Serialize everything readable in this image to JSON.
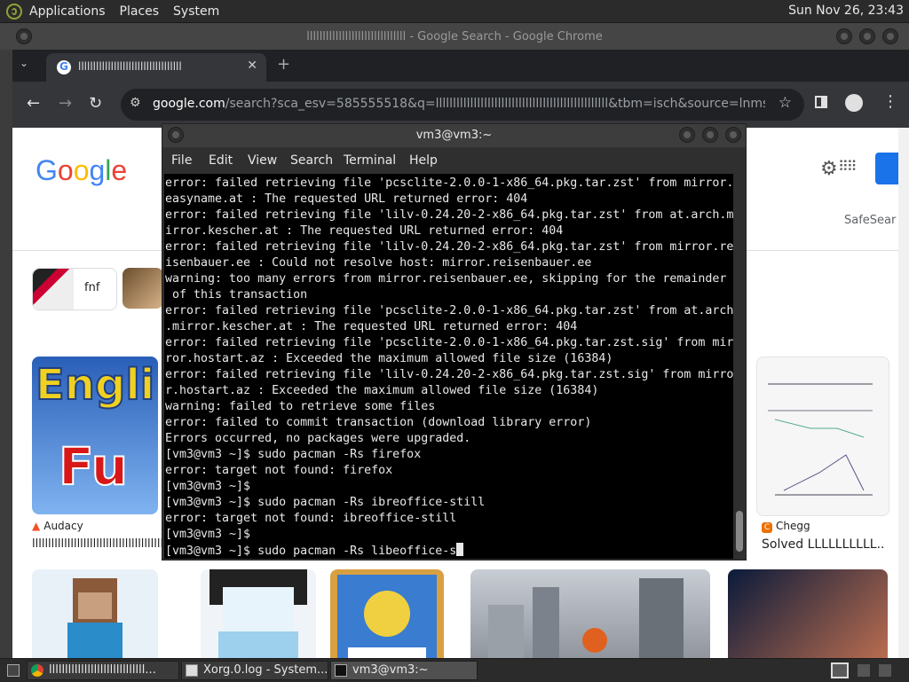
{
  "top_panel": {
    "menus": [
      "Applications",
      "Places",
      "System"
    ],
    "clock": "Sun Nov 26, 23:43"
  },
  "chrome": {
    "window_title": "lllllllllllllllllllllllllllllll - Google Search - Google Chrome",
    "tab_title": "lllllllllllllllllllllllllllllllllll",
    "url_host": "google.com",
    "url_rest": "/search?sca_esv=585555518&q=llllllllllllllllllllllllllllllllllllllllllllllllll&tbm=isch&source=lnms&sa..."
  },
  "page": {
    "logo_letters": [
      {
        "ch": "G",
        "color": "#4285f4"
      },
      {
        "ch": "o",
        "color": "#ea4335"
      },
      {
        "ch": "o",
        "color": "#fbbc05"
      },
      {
        "ch": "g",
        "color": "#4285f4"
      },
      {
        "ch": "l",
        "color": "#34a853"
      },
      {
        "ch": "e",
        "color": "#ea4335"
      }
    ],
    "safesearch": "SafeSear",
    "chip_label": "fnf",
    "card_left_text1": "Engli",
    "card_left_text2": "Fu",
    "source_left": "Audacy",
    "caption_left": "lllllllllllllllllllllllllllllllllllllllllll",
    "source_right": "Chegg",
    "caption_right": "Solved LLLLLLLLLL..."
  },
  "terminal": {
    "title": "vm3@vm3:~",
    "menus": [
      "File",
      "Edit",
      "View",
      "Search",
      "Terminal",
      "Help"
    ],
    "lines": [
      "error: failed retrieving file 'pcsclite-2.0.0-1-x86_64.pkg.tar.zst' from mirror.",
      "easyname.at : The requested URL returned error: 404",
      "error: failed retrieving file 'lilv-0.24.20-2-x86_64.pkg.tar.zst' from at.arch.m",
      "irror.kescher.at : The requested URL returned error: 404",
      "error: failed retrieving file 'lilv-0.24.20-2-x86_64.pkg.tar.zst' from mirror.re",
      "isenbauer.ee : Could not resolve host: mirror.reisenbauer.ee",
      "warning: too many errors from mirror.reisenbauer.ee, skipping for the remainder",
      " of this transaction",
      "error: failed retrieving file 'pcsclite-2.0.0-1-x86_64.pkg.tar.zst' from at.arch",
      ".mirror.kescher.at : The requested URL returned error: 404",
      "error: failed retrieving file 'pcsclite-2.0.0-1-x86_64.pkg.tar.zst.sig' from mir",
      "ror.hostart.az : Exceeded the maximum allowed file size (16384)",
      "error: failed retrieving file 'lilv-0.24.20-2-x86_64.pkg.tar.zst.sig' from mirro",
      "r.hostart.az : Exceeded the maximum allowed file size (16384)",
      "warning: failed to retrieve some files",
      "error: failed to commit transaction (download library error)",
      "Errors occurred, no packages were upgraded.",
      "[vm3@vm3 ~]$ sudo pacman -Rs firefox",
      "error: target not found: firefox",
      "[vm3@vm3 ~]$",
      "[vm3@vm3 ~]$ sudo pacman -Rs ibreoffice-still",
      "error: target not found: ibreoffice-still",
      "[vm3@vm3 ~]$",
      "[vm3@vm3 ~]$ sudo pacman -Rs libeoffice-s"
    ]
  },
  "taskbar": {
    "items": [
      {
        "label": "llllllllllllllllllllllllllllll..."
      },
      {
        "label": "Xorg.0.log - System..."
      },
      {
        "label": "vm3@vm3:~"
      }
    ]
  }
}
